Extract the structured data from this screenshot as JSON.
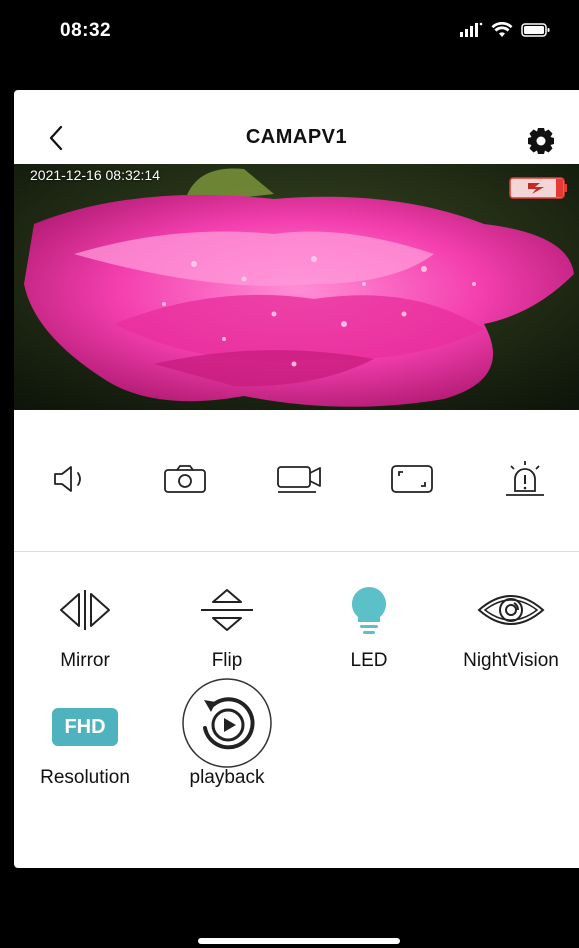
{
  "status_bar": {
    "time": "08:32"
  },
  "header": {
    "title": "CAMAPV1",
    "back_icon": "chevron-left-icon",
    "settings_icon": "gear-icon"
  },
  "video": {
    "timestamp": "2021-12-16 08:32:14",
    "battery_icon": "battery-charging-low-icon",
    "battery_color": "#e53935"
  },
  "controls": [
    {
      "name": "speaker-icon"
    },
    {
      "name": "camera-snapshot-icon"
    },
    {
      "name": "record-video-icon"
    },
    {
      "name": "fullscreen-icon"
    },
    {
      "name": "alarm-siren-icon"
    }
  ],
  "features": [
    {
      "label": "Mirror",
      "icon": "mirror-icon"
    },
    {
      "label": "Flip",
      "icon": "flip-icon"
    },
    {
      "label": "LED",
      "icon": "led-bulb-icon",
      "color": "#5bc0c8"
    },
    {
      "label": "NightVision",
      "icon": "night-vision-eye-icon"
    },
    {
      "label": "Resolution",
      "icon": "fhd-badge-icon",
      "badge_text": "FHD",
      "color": "#4fb3bf"
    },
    {
      "label": "playback",
      "icon": "playback-icon"
    }
  ]
}
